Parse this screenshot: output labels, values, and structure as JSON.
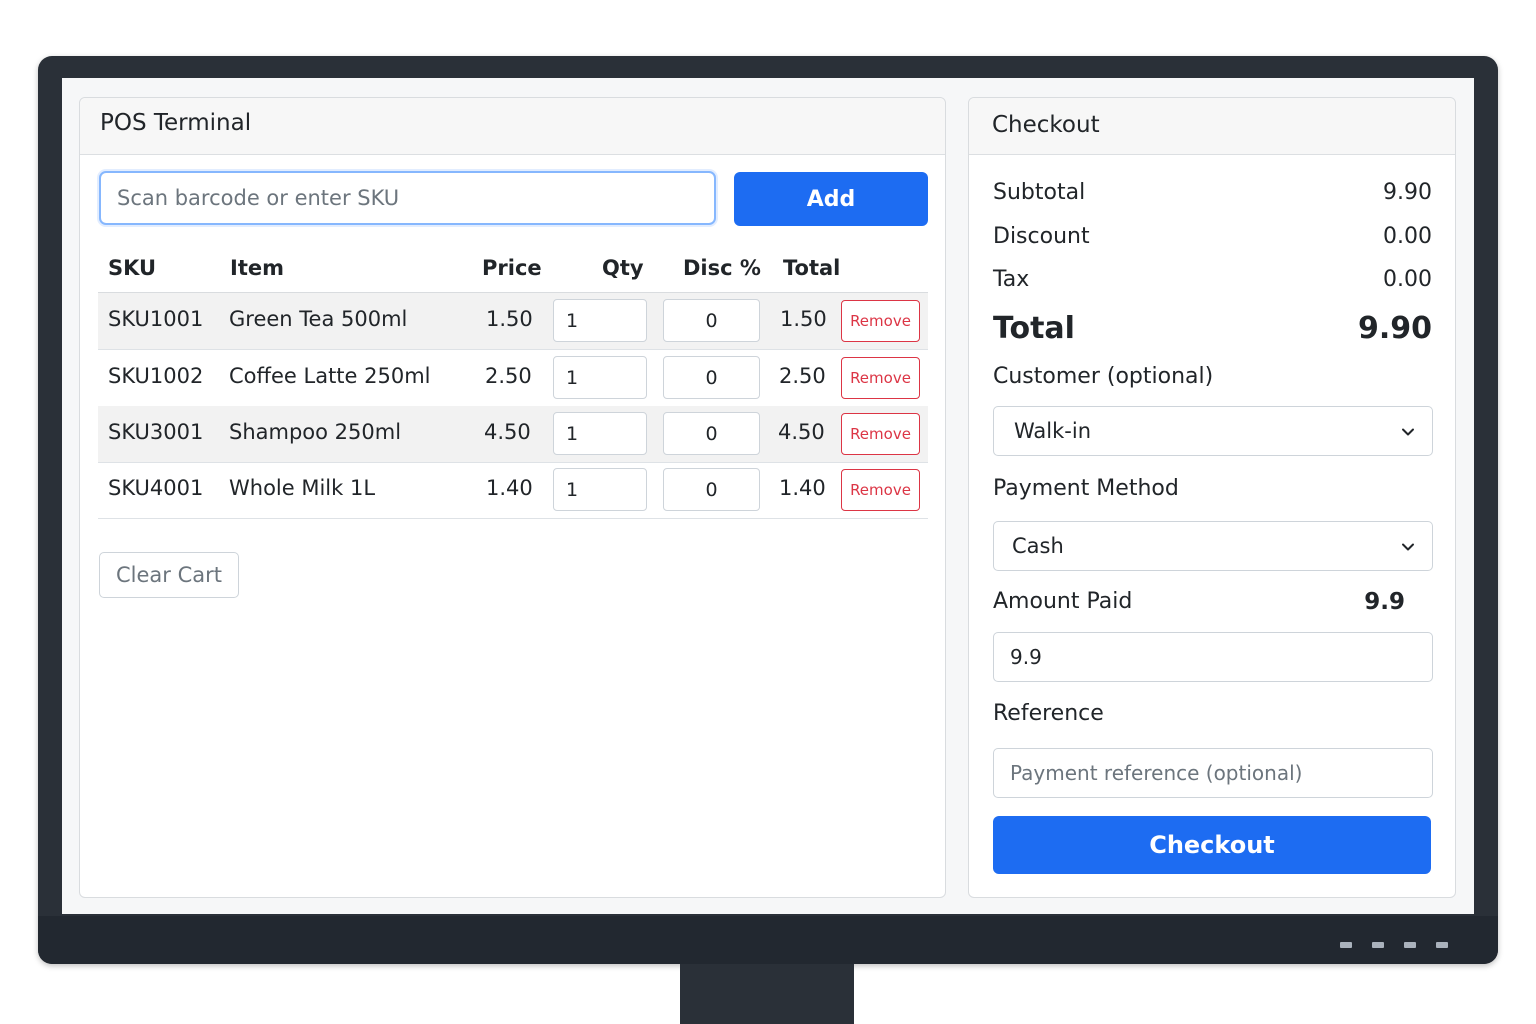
{
  "pos": {
    "title": "POS Terminal",
    "scan_placeholder": "Scan barcode or enter SKU",
    "add_label": "Add",
    "columns": [
      "SKU",
      "Item",
      "Price",
      "Qty",
      "Disc %",
      "Total"
    ],
    "rows": [
      {
        "sku": "SKU1001",
        "item": "Green Tea 500ml",
        "price": "1.50",
        "qty": "1",
        "disc": "0",
        "total": "1.50",
        "remove": "Remove"
      },
      {
        "sku": "SKU1002",
        "item": "Coffee Latte 250ml",
        "price": "2.50",
        "qty": "1",
        "disc": "0",
        "total": "2.50",
        "remove": "Remove"
      },
      {
        "sku": "SKU3001",
        "item": "Shampoo 250ml",
        "price": "4.50",
        "qty": "1",
        "disc": "0",
        "total": "4.50",
        "remove": "Remove"
      },
      {
        "sku": "SKU4001",
        "item": "Whole Milk 1L",
        "price": "1.40",
        "qty": "1",
        "disc": "0",
        "total": "1.40",
        "remove": "Remove"
      }
    ],
    "clear_label": "Clear Cart"
  },
  "checkout": {
    "title": "Checkout",
    "subtotal_label": "Subtotal",
    "subtotal": "9.90",
    "discount_label": "Discount",
    "discount": "0.00",
    "tax_label": "Tax",
    "tax": "0.00",
    "total_label": "Total",
    "total": "9.90",
    "customer_label": "Customer (optional)",
    "customer_value": "Walk-in",
    "payment_label": "Payment Method",
    "payment_value": "Cash",
    "amount_paid_label": "Amount Paid",
    "amount_paid_display": "9.9",
    "amount_paid_value": "9.9",
    "reference_label": "Reference",
    "reference_placeholder": "Payment reference (optional)",
    "button_label": "Checkout"
  },
  "colors": {
    "primary": "#1d6cf2",
    "danger": "#dc3545",
    "monitor_bezel": "#2a3038"
  }
}
